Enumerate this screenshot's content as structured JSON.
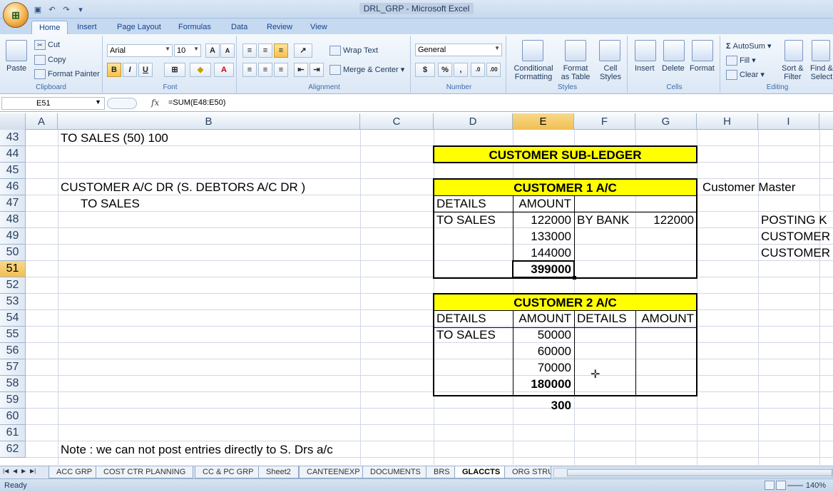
{
  "window": {
    "title": "DRL_GRP - Microsoft Excel"
  },
  "ribbon_tabs": [
    "Home",
    "Insert",
    "Page Layout",
    "Formulas",
    "Data",
    "Review",
    "View"
  ],
  "clipboard": {
    "paste": "Paste",
    "cut": "Cut",
    "copy": "Copy",
    "format_painter": "Format Painter",
    "label": "Clipboard"
  },
  "font": {
    "name": "Arial",
    "size": "10",
    "label": "Font"
  },
  "alignment": {
    "wrap_text": "Wrap Text",
    "merge_center": "Merge & Center",
    "label": "Alignment"
  },
  "number": {
    "format": "General",
    "label": "Number",
    "dollar": "$",
    "percent": "%",
    "comma": ","
  },
  "styles": {
    "conditional_1": "Conditional",
    "conditional_2": "Formatting",
    "format_table_1": "Format",
    "format_table_2": "as Table",
    "cell_styles_1": "Cell",
    "cell_styles_2": "Styles",
    "label": "Styles"
  },
  "cells": {
    "insert": "Insert",
    "delete": "Delete",
    "format": "Format",
    "label": "Cells"
  },
  "editing": {
    "autosum": "AutoSum",
    "fill": "Fill",
    "clear": "Clear",
    "sort_1": "Sort &",
    "sort_2": "Filter",
    "find_1": "Find &",
    "find_2": "Select",
    "label": "Editing"
  },
  "formula_bar": {
    "name_box": "E51",
    "fx": "fx",
    "formula": "=SUM(E48:E50)"
  },
  "columns": [
    "A",
    "B",
    "C",
    "D",
    "E",
    "F",
    "G",
    "H",
    "I"
  ],
  "rows": [
    "43",
    "44",
    "45",
    "46",
    "47",
    "48",
    "49",
    "50",
    "51",
    "52",
    "53",
    "54",
    "55",
    "56",
    "57",
    "58",
    "59",
    "60",
    "61",
    "62"
  ],
  "cells_data": {
    "r43_b": "TO SALES     (50)                 100",
    "r44_title": "CUSTOMER SUB-LEDGER",
    "r46_b": "CUSTOMER A/C DR   (S. DEBTORS A/C DR )",
    "r46_title": "CUSTOMER 1  A/C",
    "r46_h": "Customer Master",
    "r47_b": "TO SALES",
    "r47_d": "DETAILS",
    "r47_e": "AMOUNT",
    "r48_d": "TO SALES",
    "r48_e": "122000",
    "r48_f": "BY BANK",
    "r48_g": "122000",
    "r48_i": "POSTING K",
    "r49_e": "133000",
    "r49_i": "CUSTOMER",
    "r50_e": "144000",
    "r50_i": "CUSTOMER",
    "r51_e": "399000",
    "r53_title": "CUSTOMER 2  A/C",
    "r54_d": "DETAILS",
    "r54_e": "AMOUNT",
    "r54_f": "DETAILS",
    "r54_g": "AMOUNT",
    "r55_d": "TO SALES",
    "r55_e": "50000",
    "r56_e": "60000",
    "r57_e": "70000",
    "r58_e": "180000",
    "r59_e": "300",
    "r62_b": "Note : we can not post entries directly to S. Drs a/c"
  },
  "sheet_tabs": [
    "ACC GRP",
    "COST CTR PLANNING",
    "CC & PC GRP",
    "Sheet2",
    "CANTEENEXP",
    "DOCUMENTS",
    "BRS",
    "GLACCTS",
    "ORG STRU"
  ],
  "active_sheet": "GLACCTS",
  "status": {
    "ready": "Ready",
    "zoom": "140%"
  },
  "colors": {
    "highlight_yellow": "#ffff00",
    "ribbon_blue": "#c5d9f1",
    "selection_header": "#f1bf52"
  }
}
